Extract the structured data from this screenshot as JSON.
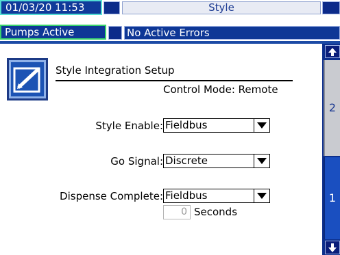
{
  "header": {
    "datetime": "01/03/20 11:53",
    "screen_title": "Style",
    "status": "Pumps Active",
    "errors": "No Active Errors"
  },
  "setup": {
    "title": "Style Integration Setup",
    "control_mode": "Control Mode: Remote",
    "icon": "setup-edit-icon"
  },
  "fields": {
    "style_enable": {
      "label": "Style Enable:",
      "value": "Fieldbus"
    },
    "go_signal": {
      "label": "Go Signal:",
      "value": "Discrete"
    },
    "dispense_complete": {
      "label": "Dispense Complete:",
      "value": "Fieldbus"
    },
    "seconds": {
      "value": "0",
      "unit": "Seconds"
    }
  },
  "nav": {
    "pages": [
      "2",
      "1"
    ],
    "up_icon": "arrow-up-icon",
    "down_icon": "arrow-down-icon"
  },
  "colors": {
    "header_blue": "#0e3796",
    "active_status_border": "#39d36c",
    "datetime_border": "#53ddd4"
  }
}
